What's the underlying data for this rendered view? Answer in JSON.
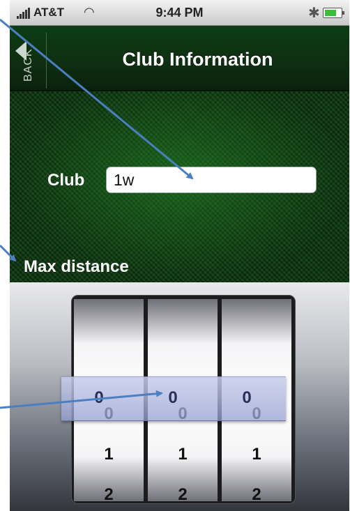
{
  "status_bar": {
    "carrier": "AT&T",
    "time": "9:44 PM"
  },
  "nav": {
    "back_label": "BACK",
    "title": "Club Information"
  },
  "form": {
    "club_label": "Club",
    "club_value": "1w",
    "max_distance_label": "Max distance"
  },
  "picker": {
    "wheels": [
      {
        "values": [
          "0",
          "1",
          "2"
        ]
      },
      {
        "values": [
          "0",
          "1",
          "2"
        ]
      },
      {
        "values": [
          "0",
          "1",
          "2"
        ]
      }
    ],
    "selected": [
      "0",
      "0",
      "0"
    ]
  },
  "colors": {
    "nav_green": "#0f2f12",
    "background_green": "#0f3a12",
    "annotation_arrow": "#4a7fc1"
  }
}
